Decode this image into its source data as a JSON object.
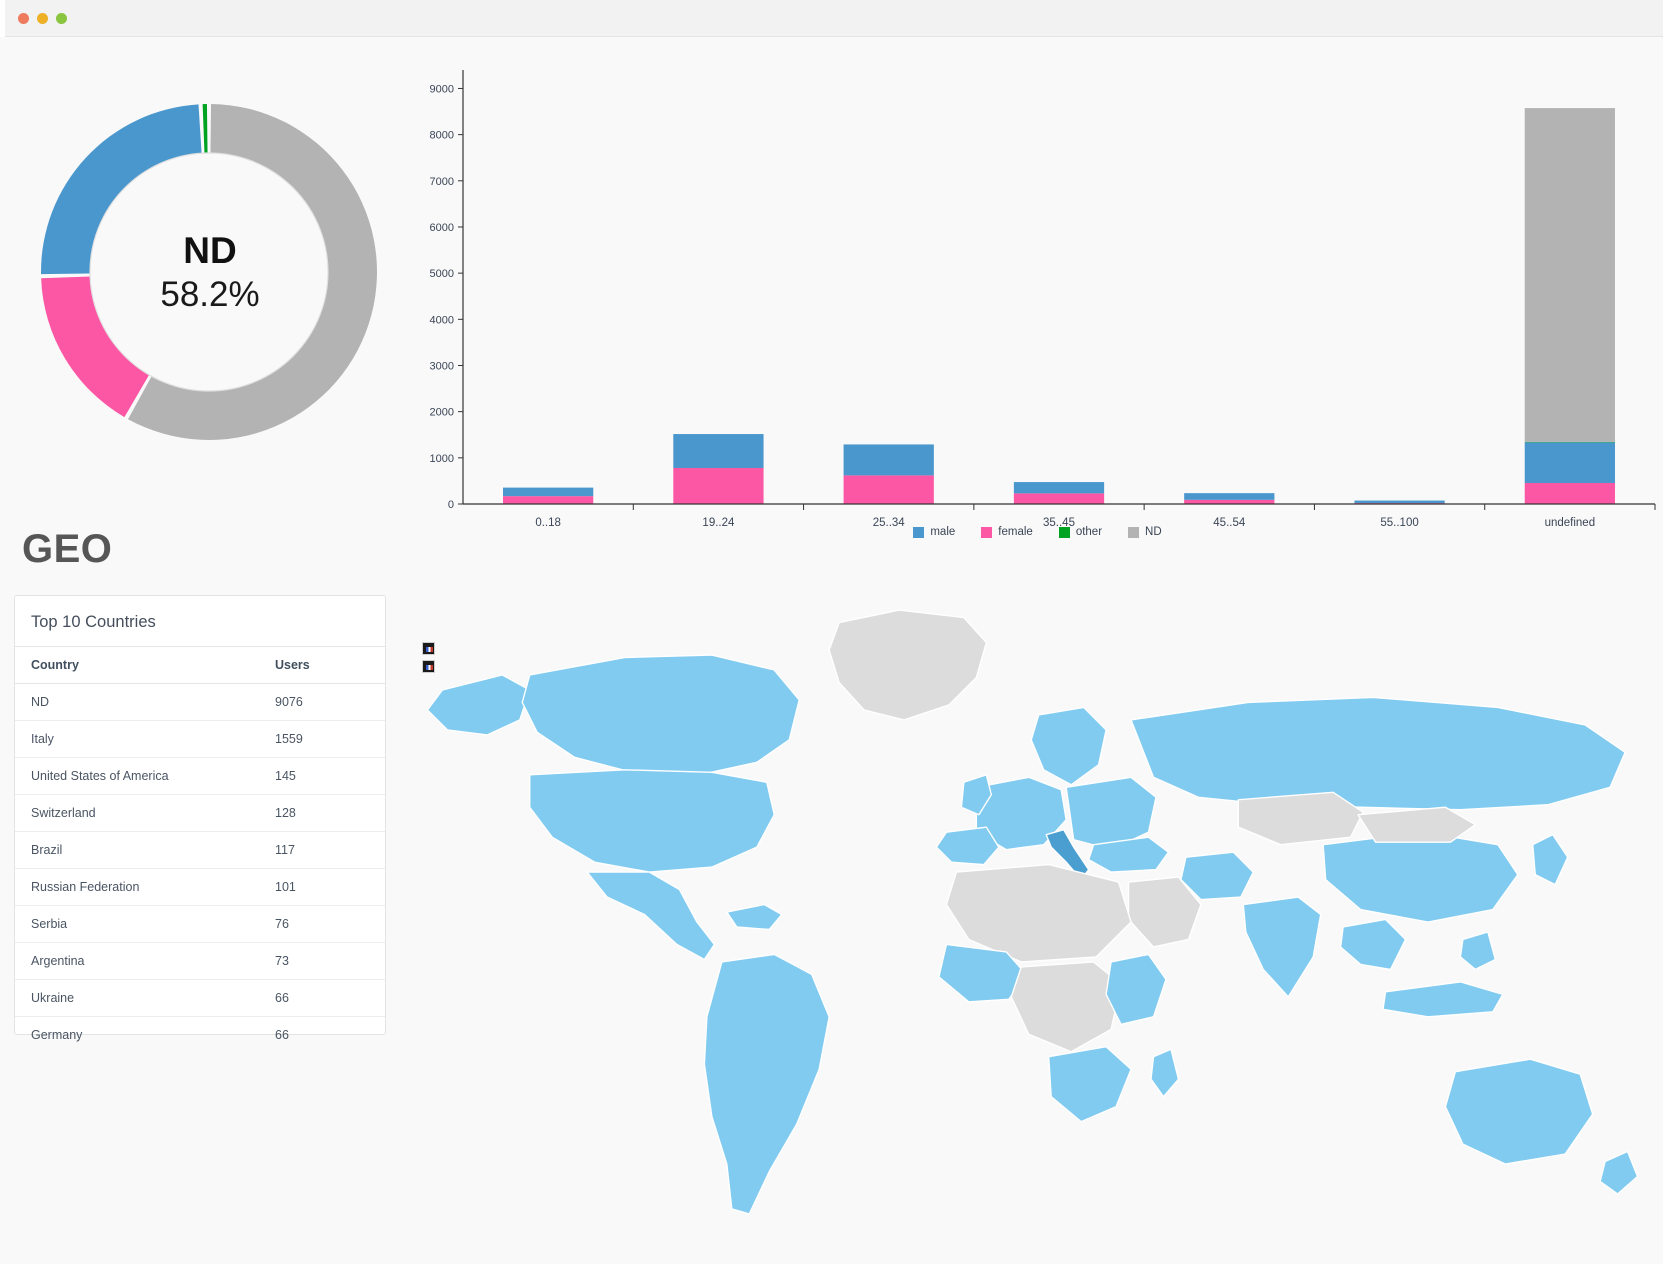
{
  "window": {
    "traffic_lights": [
      "close",
      "minimize",
      "maximize"
    ],
    "colors": {
      "close": "#ee7b5d",
      "minimize": "#edb027",
      "maximize": "#8ac53f"
    }
  },
  "palette": {
    "male": "#4a97cd",
    "female": "#fc57a4",
    "other": "#00a321",
    "nd": "#b3b3b3",
    "map_active": "#82cbf0",
    "map_inactive": "#dcdcdc",
    "map_highlight": "#4a9fd0",
    "background": "#f9f9f9"
  },
  "donut": {
    "center_title": "ND",
    "center_percent": "58.2%",
    "segments": [
      {
        "label": "ND",
        "percent": 58.2,
        "color": "#b3b3b3"
      },
      {
        "label": "female",
        "percent": 16.4,
        "color": "#fc57a4"
      },
      {
        "label": "male",
        "percent": 24.6,
        "color": "#4a97cd"
      },
      {
        "label": "other",
        "percent": 0.8,
        "color": "#00a321"
      }
    ]
  },
  "chart_data": {
    "type": "bar",
    "stacked": true,
    "title": "",
    "xlabel": "",
    "ylabel": "",
    "ylim": [
      0,
      9400
    ],
    "yticks": [
      0,
      1000,
      2000,
      3000,
      4000,
      5000,
      6000,
      7000,
      8000,
      9000
    ],
    "grid": false,
    "legend_position": "bottom",
    "categories": [
      "0..18",
      "19..24",
      "25..34",
      "35..45",
      "45..54",
      "55..100",
      "undefined"
    ],
    "series": [
      {
        "name": "female",
        "color": "#fc57a4",
        "values": [
          170,
          780,
          620,
          230,
          90,
          20,
          455
        ]
      },
      {
        "name": "male",
        "color": "#4a97cd",
        "values": [
          185,
          735,
          670,
          245,
          145,
          55,
          880
        ]
      },
      {
        "name": "other",
        "color": "#00a321",
        "values": [
          0,
          0,
          0,
          0,
          0,
          0,
          10
        ]
      },
      {
        "name": "ND",
        "color": "#b3b3b3",
        "values": [
          0,
          0,
          0,
          0,
          0,
          0,
          7230
        ]
      }
    ]
  },
  "legend": [
    {
      "label": "male",
      "color": "#4a97cd"
    },
    {
      "label": "female",
      "color": "#fc57a4"
    },
    {
      "label": "other",
      "color": "#00a321"
    },
    {
      "label": "ND",
      "color": "#b3b3b3"
    }
  ],
  "geo": {
    "section_title": "GEO",
    "card_title": "Top 10 Countries",
    "columns": [
      "Country",
      "Users"
    ],
    "rows": [
      {
        "country": "ND",
        "users": "9076"
      },
      {
        "country": "Italy",
        "users": "1559"
      },
      {
        "country": "United States of America",
        "users": "145"
      },
      {
        "country": "Switzerland",
        "users": "128"
      },
      {
        "country": "Brazil",
        "users": "117"
      },
      {
        "country": "Russian Federation",
        "users": "101"
      },
      {
        "country": "Serbia",
        "users": "76"
      },
      {
        "country": "Argentina",
        "users": "73"
      },
      {
        "country": "Ukraine",
        "users": "66"
      },
      {
        "country": "Germany",
        "users": "66"
      }
    ]
  },
  "map": {
    "controls": [
      {
        "name": "zoom-in",
        "label": "+"
      },
      {
        "name": "zoom-out",
        "label": "-"
      }
    ]
  }
}
